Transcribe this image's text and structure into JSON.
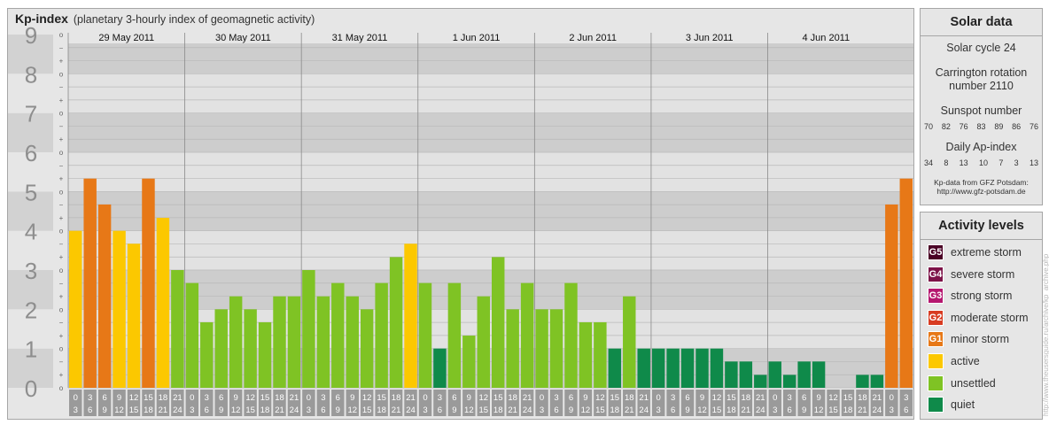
{
  "title": {
    "main": "Kp-index",
    "subtitle": "(planetary 3-hourly index of geomagnetic activity)"
  },
  "chart_data": {
    "type": "bar",
    "title": "Kp-index",
    "subtitle": "(planetary 3-hourly index of geomagnetic activity)",
    "ylim": [
      0,
      9
    ],
    "y_ticks": [
      "0",
      "1",
      "2",
      "3",
      "4",
      "5",
      "6",
      "7",
      "8",
      "9"
    ],
    "y_minor_ticks": [
      "o",
      "+",
      "−"
    ],
    "grid": true,
    "days": [
      "29 May 2011",
      "30 May 2011",
      "31 May 2011",
      "1 Jun 2011",
      "2 Jun 2011",
      "3 Jun 2011",
      "4 Jun 2011"
    ],
    "interval_start_labels": [
      "0",
      "3",
      "6",
      "9",
      "12",
      "15",
      "18",
      "21"
    ],
    "interval_end_labels": [
      "3",
      "6",
      "9",
      "12",
      "15",
      "18",
      "21",
      "24"
    ],
    "values": [
      4.0,
      5.33,
      4.67,
      4.0,
      3.67,
      5.33,
      4.33,
      3.0,
      2.67,
      1.67,
      2.0,
      2.33,
      2.0,
      1.67,
      2.33,
      2.33,
      3.0,
      2.33,
      2.67,
      2.33,
      2.0,
      2.67,
      3.33,
      3.67,
      2.67,
      1.0,
      2.67,
      1.33,
      2.33,
      3.33,
      2.0,
      2.67,
      2.0,
      2.0,
      2.67,
      1.67,
      1.67,
      1.0,
      2.33,
      1.0,
      1.0,
      1.0,
      1.0,
      1.0,
      1.0,
      0.67,
      0.67,
      0.33,
      0.67,
      0.33,
      0.67,
      0.67,
      0.0,
      0.0,
      0.33,
      0.33,
      4.67,
      5.33
    ],
    "levels": [
      {
        "name": "quiet",
        "max": 1.0,
        "color": "#0f8a4a"
      },
      {
        "name": "unsettled",
        "max": 3.5,
        "color": "#7fc324"
      },
      {
        "name": "active",
        "max": 4.5,
        "color": "#fcc800"
      },
      {
        "name": "minor storm",
        "max": 9.0,
        "color": "#e77817"
      }
    ],
    "band_colors": [
      "#cdcdcd",
      "#e2e2e2"
    ],
    "minor_line_color": "#b8b8b8",
    "day_line_color": "#8a8a8a",
    "axis_label_bg": "#9a9a9a",
    "axis_label_color": "#ffffff",
    "big_digit_color": "#8e8e8e"
  },
  "solar": {
    "header": "Solar data",
    "cycle": "Solar cycle 24",
    "carrington_line1": "Carrington rotation",
    "carrington_line2": "number 2110",
    "sunspot_title": "Sunspot number",
    "sunspot_values": [
      "70",
      "82",
      "76",
      "83",
      "89",
      "86",
      "76"
    ],
    "ap_title": "Daily Ap-index",
    "ap_values": [
      "34",
      "8",
      "13",
      "10",
      "7",
      "3",
      "13"
    ],
    "source_line1": "Kp-data from GFZ Potsdam:",
    "source_line2": "http://www.gfz-potsdam.de"
  },
  "activity": {
    "header": "Activity levels",
    "items": [
      {
        "code": "G5",
        "label": "extreme storm",
        "color": "#4a0025"
      },
      {
        "code": "G4",
        "label": "severe storm",
        "color": "#7d1348"
      },
      {
        "code": "G3",
        "label": "strong storm",
        "color": "#b5176f"
      },
      {
        "code": "G2",
        "label": "moderate storm",
        "color": "#d83c22"
      },
      {
        "code": "G1",
        "label": "minor storm",
        "color": "#e77817"
      },
      {
        "code": "",
        "label": "active",
        "color": "#fcc800"
      },
      {
        "code": "",
        "label": "unsettled",
        "color": "#7fc324"
      },
      {
        "code": "",
        "label": "quiet",
        "color": "#0f8a4a"
      }
    ]
  },
  "watermark": "http://www.theusersguide.ru/archive/kp_archive.php"
}
